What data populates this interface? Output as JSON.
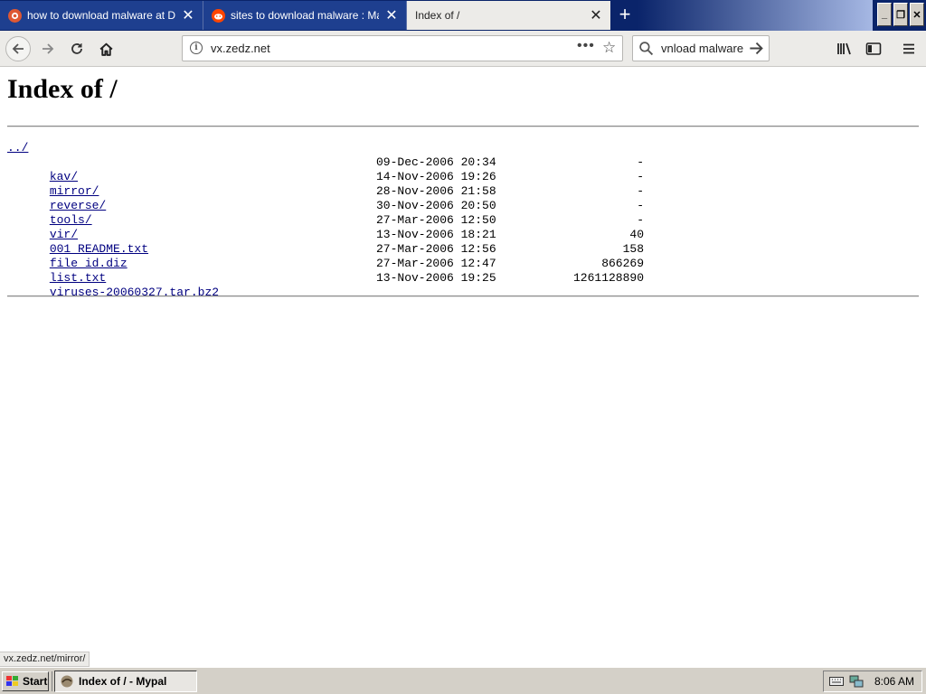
{
  "browser": {
    "tabs": [
      {
        "title": "how to download malware at DuckDuckGo",
        "favicon": "duckduckgo-icon"
      },
      {
        "title": "sites to download malware : Malware",
        "favicon": "reddit-icon"
      },
      {
        "title": "Index of /",
        "favicon": ""
      }
    ],
    "new_tab_glyph": "+",
    "window_buttons": {
      "minimize": "_",
      "restore": "❐",
      "close": "✕"
    }
  },
  "navbar": {
    "url": "vx.zedz.net",
    "page_actions_glyph": "•••",
    "bookmark_glyph": "☆",
    "search_value": "vnload malware"
  },
  "page": {
    "heading": "Index of /",
    "parent_link": "../",
    "entries": [
      {
        "name": "kav/",
        "date": "09-Dec-2006 20:34",
        "size": "-"
      },
      {
        "name": "mirror/",
        "date": "14-Nov-2006 19:26",
        "size": "-"
      },
      {
        "name": "reverse/",
        "date": "28-Nov-2006 21:58",
        "size": "-"
      },
      {
        "name": "tools/",
        "date": "30-Nov-2006 20:50",
        "size": "-"
      },
      {
        "name": "vir/",
        "date": "27-Mar-2006 12:50",
        "size": "-"
      },
      {
        "name": "001_README.txt",
        "date": "13-Nov-2006 18:21",
        "size": "40"
      },
      {
        "name": "file_id.diz",
        "date": "27-Mar-2006 12:56",
        "size": "158"
      },
      {
        "name": "list.txt",
        "date": "27-Mar-2006 12:47",
        "size": "866269"
      },
      {
        "name": "viruses-20060327.tar.bz2",
        "date": "13-Nov-2006 19:25",
        "size": "1261128890"
      }
    ]
  },
  "status": {
    "hover_url": "vx.zedz.net/mirror/"
  },
  "taskbar": {
    "start_label": "Start",
    "task_label": "Index of / - Mypal",
    "clock": "8:06 AM"
  },
  "colors": {
    "link": "#000080",
    "tabstrip": "#0a246a",
    "taskbar": "#d4d0c8"
  }
}
